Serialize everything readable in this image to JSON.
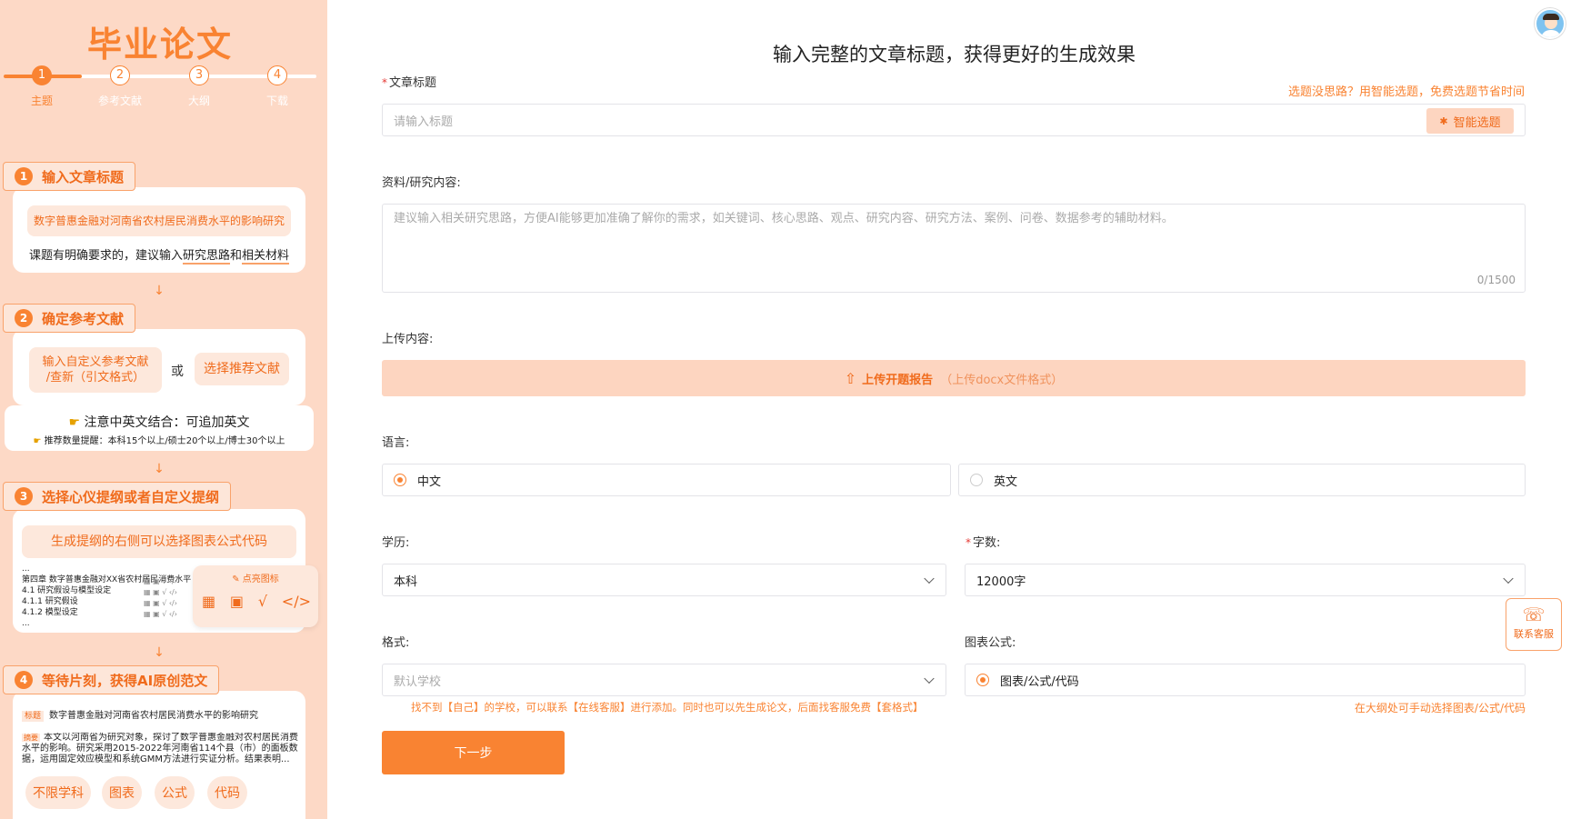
{
  "sidebar": {
    "logo": "毕业论文",
    "steps": [
      {
        "num": "1",
        "label": "主题"
      },
      {
        "num": "2",
        "label": "参考文献"
      },
      {
        "num": "3",
        "label": "大纲"
      },
      {
        "num": "4",
        "label": "下载"
      }
    ],
    "sections": [
      {
        "num": "1",
        "title": "输入文章标题",
        "example": "数字普惠金融对河南省农村居民消费水平的影响研究",
        "note_prefix": "课题有明确要求的，建议输入",
        "note_hl1": "研究思路",
        "note_mid": "和",
        "note_hl2": "相关材料"
      },
      {
        "num": "2",
        "title": "确定参考文献",
        "option_a_line1": "输入自定义参考文献",
        "option_a_line2": "/查新（引文格式）",
        "or": "或",
        "option_b": "选择推荐文献",
        "tip_main": "注意中英文结合：可追加英文",
        "tip_sub": "推荐数量提醒：本科15个以上/硕士20个以上/博士30个以上"
      },
      {
        "num": "3",
        "title": "选择心仪提纲或者自定义提纲",
        "banner": "生成提纲的右侧可以选择图表公式代码",
        "outline": [
          "...",
          "第四章 数字普惠金融对XX省农村居民消费水平",
          "4.1 研究假设与模型设定",
          "4.1.1 研究假设",
          "4.1.2 模型设定",
          "..."
        ],
        "popup_title": "点亮图标"
      },
      {
        "num": "4",
        "title": "等待片刻，获得AI原创范文",
        "title_tag": "标题",
        "title_text": "数字普惠金融对河南省农村居民消费水平的影响研究",
        "abstract_tag": "摘要",
        "abstract_text": "本文以河南省为研究对象，探讨了数字普惠金融对农村居民消费水平的影响。研究采用2015-2022年河南省114个县（市）的面板数据，运用固定效应模型和系统GMM方法进行实证分析。结果表明...",
        "chips": [
          "不限学科",
          "图表",
          "公式",
          "代码"
        ]
      }
    ]
  },
  "main": {
    "heading": "输入完整的文章标题，获得更好的生成效果",
    "title_label": "文章标题",
    "title_hint": "选题没思路？用智能选题，免费选题节省时间",
    "title_placeholder": "请输入标题",
    "smart_btn": "智能选题",
    "material_label": "资料/研究内容:",
    "material_placeholder": "建议输入相关研究思路，方便AI能够更加准确了解你的需求，如关键词、核心思路、观点、研究内容、研究方法、案例、问卷、数据参考的辅助材料。",
    "material_count": "0/1500",
    "upload_label": "上传内容:",
    "upload_btn": "上传开题报告",
    "upload_note": "（上传docx文件格式）",
    "lang_label": "语言:",
    "lang_options": [
      "中文",
      "英文"
    ],
    "lang_selected": "中文",
    "edu_label": "学历:",
    "edu_value": "本科",
    "words_label": "字数:",
    "words_value": "12000字",
    "format_label": "格式:",
    "format_placeholder": "默认学校",
    "format_hint": "找不到【自己】的学校，可以联系【在线客服】进行添加。同时也可以先生成论文，后面找客服免费【套格式】",
    "chart_label": "图表公式:",
    "chart_value": "图表/公式/代码",
    "chart_hint": "在大纲处可手动选择图表/公式/代码",
    "next_btn": "下一步",
    "service_label": "联系客服"
  },
  "colors": {
    "accent": "#f98332",
    "sidebar_bg": "#fdd9c6",
    "upload_bg": "#fdd5c0"
  }
}
